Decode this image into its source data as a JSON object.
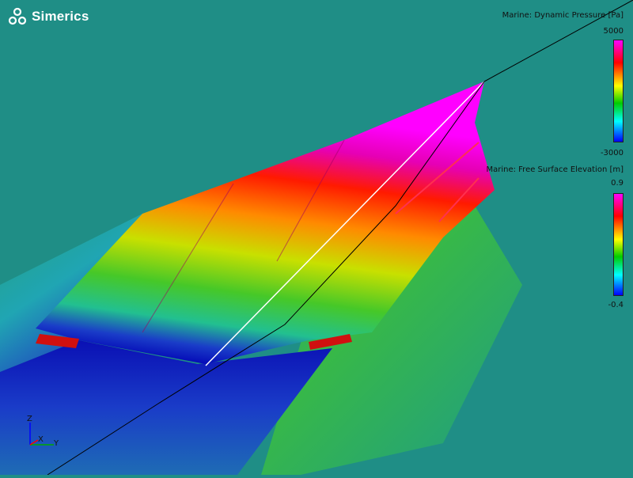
{
  "app": {
    "name": "Simerics"
  },
  "legends": [
    {
      "title": "Marine: Dynamic Pressure [Pa]",
      "max": "5000",
      "min": "-3000"
    },
    {
      "title": "Marine: Free Surface Elevation [m]",
      "max": "0.9",
      "min": "-0.4"
    }
  ],
  "axes": {
    "z": "Z",
    "x": "X",
    "y": "Y"
  },
  "colors": {
    "water": "#1f8e86",
    "colormap": [
      "#ff00ff",
      "#ff0000",
      "#ffff00",
      "#00cc00",
      "#00ffff",
      "#0000ff"
    ]
  }
}
